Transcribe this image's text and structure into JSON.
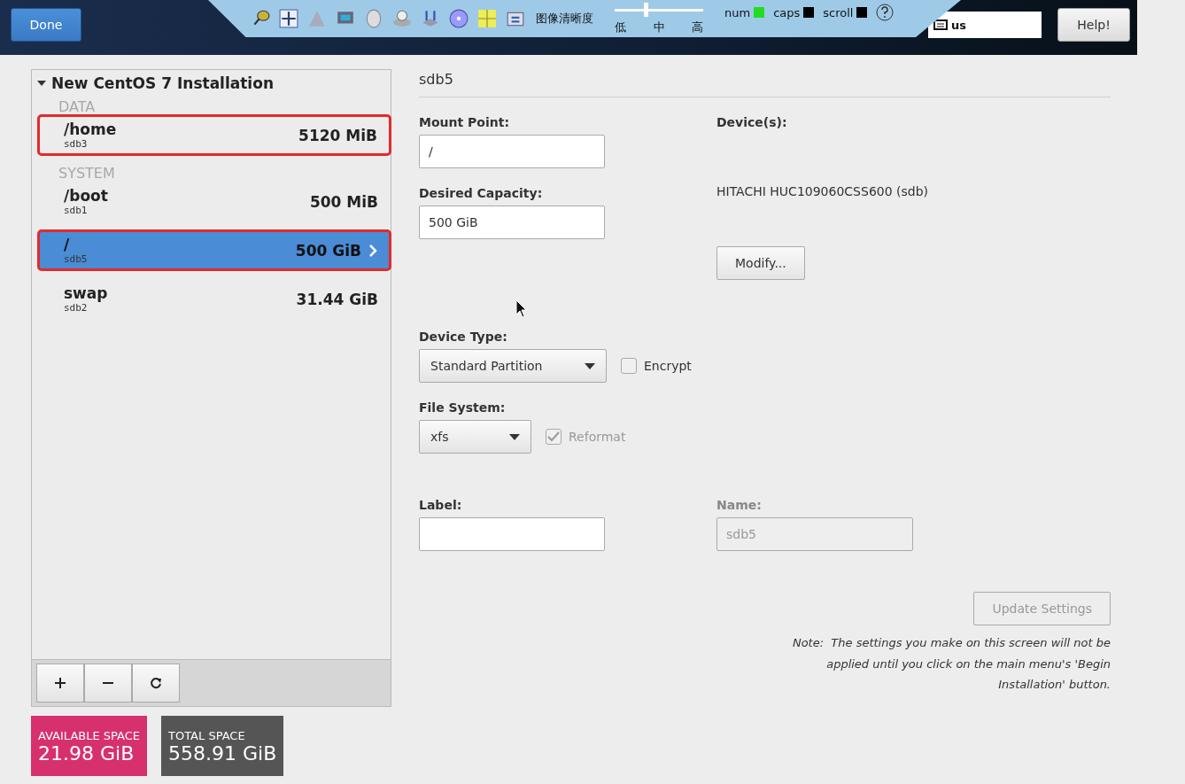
{
  "header": {
    "done_button": "Done",
    "help_button": "Help!",
    "keyboard": "us"
  },
  "remote_toolbar": {
    "image_quality_label": "图像清晰度",
    "quality_slider": {
      "level": 0.35,
      "ticks": [
        "低",
        "中",
        "高"
      ]
    },
    "indicators": [
      {
        "label": "num",
        "on": true
      },
      {
        "label": "caps",
        "on": false
      },
      {
        "label": "scroll",
        "on": false
      }
    ]
  },
  "partitions": {
    "title": "New CentOS 7 Installation",
    "expanded": true,
    "groups": [
      {
        "name": "DATA",
        "items": [
          {
            "mount": "/home",
            "device": "sdb3",
            "size": "5120 MiB",
            "selected": false,
            "annotated": true
          }
        ]
      },
      {
        "name": "SYSTEM",
        "items": [
          {
            "mount": "/boot",
            "device": "sdb1",
            "size": "500 MiB",
            "selected": false,
            "annotated": false
          },
          {
            "mount": "/",
            "device": "sdb5",
            "size": "500 GiB",
            "selected": true,
            "annotated": true
          },
          {
            "mount": "swap",
            "device": "sdb2",
            "size": "31.44 GiB",
            "selected": false,
            "annotated": false
          }
        ]
      }
    ]
  },
  "space": [
    {
      "kind": "available",
      "label": "AVAILABLE SPACE",
      "value": "21.98 GiB"
    },
    {
      "kind": "total",
      "label": "TOTAL SPACE",
      "value": "558.91 GiB"
    }
  ],
  "details": {
    "title": "sdb5",
    "mount_point": {
      "label": "Mount Point:",
      "value": "/"
    },
    "desired_capacity": {
      "label": "Desired Capacity:",
      "value": "500 GiB"
    },
    "devices": {
      "label": "Device(s):",
      "value": "HITACHI HUC109060CSS600 (sdb)"
    },
    "modify_button": "Modify...",
    "device_type": {
      "label": "Device Type:",
      "value": "Standard Partition",
      "encrypt": {
        "label": "Encrypt",
        "checked": false,
        "disabled": false
      }
    },
    "file_system": {
      "label": "File System:",
      "value": "xfs",
      "reformat": {
        "label": "Reformat",
        "checked": true,
        "disabled": true
      }
    },
    "label_field": {
      "label": "Label:"
    },
    "name_field": {
      "label": "Name:",
      "value": "sdb5",
      "disabled": true
    },
    "update_button": {
      "label": "Update Settings",
      "disabled": true
    },
    "note": "Note:  The settings you make on this screen will not be applied until you click on the main menu's 'Begin Installation' button."
  }
}
